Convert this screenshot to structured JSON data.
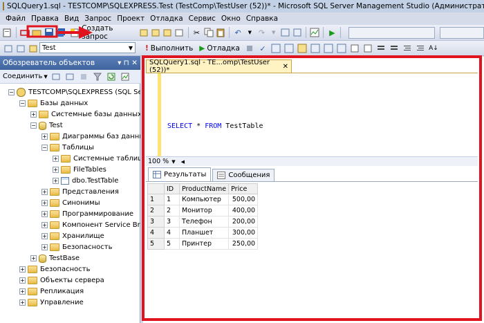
{
  "window": {
    "title": "SQLQuery1.sql - TESTCOMP\\SQLEXPRESS.Test (TestComp\\TestUser (52))* - Microsoft SQL Server Management Studio (Администратор)"
  },
  "menu": [
    "Файл",
    "Правка",
    "Вид",
    "Запрос",
    "Проект",
    "Отладка",
    "Сервис",
    "Окно",
    "Справка"
  ],
  "toolbar": {
    "new_query_label": "Создать запрос"
  },
  "query_toolbar": {
    "database_selected": "Test",
    "execute_label": "Выполнить",
    "debug_label": "Отладка"
  },
  "object_explorer": {
    "title": "Обозреватель объектов",
    "pin": "▾ ⊓ ✕",
    "connect_label": "Соединить",
    "tree": [
      {
        "label": "TESTCOMP\\SQLEXPRESS (SQL Server",
        "icon": "server-icon",
        "expander": "−"
      },
      {
        "label": "Базы данных",
        "icon": "folder-icon",
        "expander": "−"
      },
      {
        "label": "Системные базы данных",
        "icon": "folder-icon",
        "expander": "+"
      },
      {
        "label": "Test",
        "icon": "database-icon",
        "expander": "−"
      },
      {
        "label": "Диаграммы баз данных",
        "icon": "folder-icon",
        "expander": "+"
      },
      {
        "label": "Таблицы",
        "icon": "folder-icon",
        "expander": "−"
      },
      {
        "label": "Системные таблицы",
        "icon": "folder-icon",
        "expander": "+"
      },
      {
        "label": "FileTables",
        "icon": "folder-icon",
        "expander": "+"
      },
      {
        "label": "dbo.TestTable",
        "icon": "table-icon",
        "expander": "+"
      },
      {
        "label": "Представления",
        "icon": "folder-icon",
        "expander": "+"
      },
      {
        "label": "Синонимы",
        "icon": "folder-icon",
        "expander": "+"
      },
      {
        "label": "Программирование",
        "icon": "folder-icon",
        "expander": "+"
      },
      {
        "label": "Компонент Service Brok",
        "icon": "folder-icon",
        "expander": "+"
      },
      {
        "label": "Хранилище",
        "icon": "folder-icon",
        "expander": "+"
      },
      {
        "label": "Безопасность",
        "icon": "folder-icon",
        "expander": "+"
      },
      {
        "label": "TestBase",
        "icon": "database-icon",
        "expander": "+"
      },
      {
        "label": "Безопасность",
        "icon": "folder-icon",
        "expander": "+"
      },
      {
        "label": "Объекты сервера",
        "icon": "folder-icon",
        "expander": "+"
      },
      {
        "label": "Репликация",
        "icon": "folder-icon",
        "expander": "+"
      },
      {
        "label": "Управление",
        "icon": "folder-icon",
        "expander": "+"
      }
    ]
  },
  "editor": {
    "tab_label": "SQLQuery1.sql - TE...omp\\TestUser (52))*",
    "tab_close": "✕",
    "code": {
      "kw1": "SELECT",
      "star": " * ",
      "kw2": "FROM",
      "table": " TestTable"
    },
    "zoom": "100 %"
  },
  "results": {
    "tabs": [
      "Результаты",
      "Сообщения"
    ],
    "columns": [
      "",
      "ID",
      "ProductName",
      "Price"
    ],
    "rows": [
      [
        "1",
        "1",
        "Компьютер",
        "500,00"
      ],
      [
        "2",
        "2",
        "Монитор",
        "400,00"
      ],
      [
        "3",
        "3",
        "Телефон",
        "200,00"
      ],
      [
        "4",
        "4",
        "Планшет",
        "300,00"
      ],
      [
        "5",
        "5",
        "Принтер",
        "250,00"
      ]
    ]
  },
  "colors": {
    "highlight": "#e0141e",
    "header": "#3f649e"
  }
}
